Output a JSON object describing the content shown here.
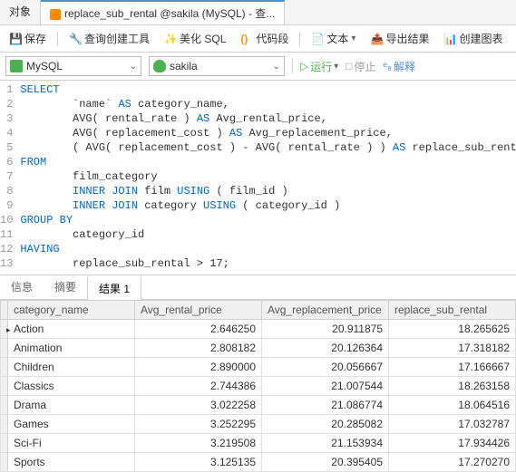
{
  "tabs": {
    "object": "对象",
    "query": "replace_sub_rental @sakila (MySQL) - 查..."
  },
  "toolbar": {
    "save": "保存",
    "builder": "查询创建工具",
    "beautify": "美化 SQL",
    "snippet": "代码段",
    "text": "文本",
    "export": "导出结果",
    "chart": "创建图表"
  },
  "dd": {
    "conn": "MySQL",
    "db": "sakila",
    "run": "运行",
    "stop": "停止",
    "explain": "解释"
  },
  "code": {
    "l1": "SELECT",
    "l2a": "\t`name` ",
    "l2b": "AS",
    "l2c": " category_name,",
    "l3a": "\tAVG( rental_rate ) ",
    "l3b": "AS",
    "l3c": " Avg_rental_price,",
    "l4a": "\tAVG( replacement_cost ) ",
    "l4b": "AS",
    "l4c": " Avg_replacement_price,",
    "l5a": "\t( AVG( replacement_cost ) - AVG( rental_rate ) ) ",
    "l5b": "AS",
    "l5c": " replace_sub_rental ",
    "l6": "FROM",
    "l7": "\tfilm_category",
    "l8a": "\t",
    "l8b": "INNER JOIN",
    "l8c": " film ",
    "l8d": "USING",
    "l8e": " ( film_id )",
    "l9a": "\t",
    "l9b": "INNER JOIN",
    "l9c": " category ",
    "l9d": "USING",
    "l9e": " ( category_id ) ",
    "l10": "GROUP BY",
    "l11": "\tcategory_id ",
    "l12": "HAVING",
    "l13a": "\treplace_sub_rental > ",
    "l13b": "17",
    "l13c": ";"
  },
  "rtabs": {
    "info": "信息",
    "profile": "摘要",
    "result": "结果 1"
  },
  "cols": {
    "c1": "category_name",
    "c2": "Avg_rental_price",
    "c3": "Avg_replacement_price",
    "c4": "replace_sub_rental"
  },
  "rows": [
    {
      "c1": "Action",
      "c2": "2.646250",
      "c3": "20.911875",
      "c4": "18.265625"
    },
    {
      "c1": "Animation",
      "c2": "2.808182",
      "c3": "20.126364",
      "c4": "17.318182"
    },
    {
      "c1": "Children",
      "c2": "2.890000",
      "c3": "20.056667",
      "c4": "17.166667"
    },
    {
      "c1": "Classics",
      "c2": "2.744386",
      "c3": "21.007544",
      "c4": "18.263158"
    },
    {
      "c1": "Drama",
      "c2": "3.022258",
      "c3": "21.086774",
      "c4": "18.064516"
    },
    {
      "c1": "Games",
      "c2": "3.252295",
      "c3": "20.285082",
      "c4": "17.032787"
    },
    {
      "c1": "Sci-Fi",
      "c2": "3.219508",
      "c3": "21.153934",
      "c4": "17.934426"
    },
    {
      "c1": "Sports",
      "c2": "3.125135",
      "c3": "20.395405",
      "c4": "17.270270"
    }
  ]
}
